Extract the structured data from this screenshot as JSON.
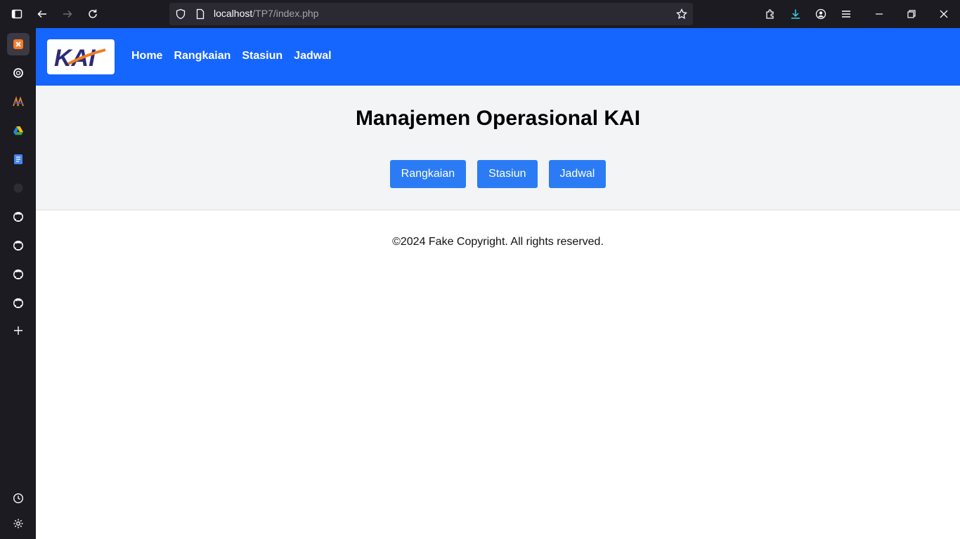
{
  "browser": {
    "url_host": "localhost",
    "url_path": "/TP7/index.php"
  },
  "sidebar": {
    "items": [
      {
        "icon": "xampp-icon"
      },
      {
        "icon": "openai-icon"
      },
      {
        "icon": "kai-icon"
      },
      {
        "icon": "google-drive-icon"
      },
      {
        "icon": "google-docs-icon"
      },
      {
        "icon": "github-faded-icon"
      },
      {
        "icon": "github-icon"
      },
      {
        "icon": "github-icon"
      },
      {
        "icon": "github-icon"
      },
      {
        "icon": "github-icon"
      },
      {
        "icon": "plus-icon"
      }
    ],
    "bottom": [
      {
        "icon": "history-icon"
      },
      {
        "icon": "gear-icon"
      }
    ]
  },
  "navbar": {
    "logo_text": "KAI",
    "links": [
      "Home",
      "Rangkaian",
      "Stasiun",
      "Jadwal"
    ]
  },
  "hero": {
    "title": "Manajemen Operasional KAI",
    "buttons": [
      "Rangkaian",
      "Stasiun",
      "Jadwal"
    ]
  },
  "footer": {
    "text": "©2024 Fake Copyright. All rights reserved."
  },
  "colors": {
    "navbar": "#1565ff",
    "button": "#2b7bf5",
    "hero_bg": "#f2f4f6"
  }
}
